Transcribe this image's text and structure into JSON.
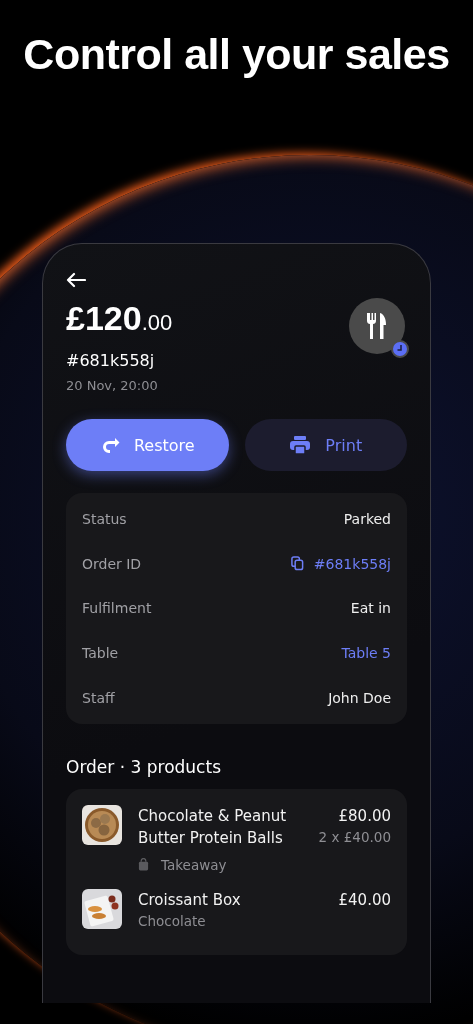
{
  "headline": "Control all your sales",
  "order": {
    "amount_main": "£120",
    "amount_cents": ".00",
    "id": "#681k558j",
    "date": "20 Nov, 20:00",
    "pending": true
  },
  "buttons": [
    {
      "label": "Restore",
      "kind": "primary"
    },
    {
      "label": "Print",
      "kind": "secondary"
    }
  ],
  "details": [
    {
      "label": "Status",
      "value": "Parked",
      "kind": "plain"
    },
    {
      "label": "Order ID",
      "value": "#681k558j",
      "kind": "copy"
    },
    {
      "label": "Fulfilment",
      "value": "Eat in",
      "kind": "plain"
    },
    {
      "label": "Table",
      "value": "Table 5",
      "kind": "link"
    },
    {
      "label": "Staff",
      "value": "John Doe",
      "kind": "plain"
    }
  ],
  "order_heading": "Order · 3 products",
  "products": [
    {
      "name": "Chocolate & Peanut Butter Protein Balls",
      "price": "£80.00",
      "unit_price": "2 x £40.00",
      "tag": "Takeaway",
      "kind": "picture"
    },
    {
      "name": "Croissant Box",
      "price": "£40.00",
      "variant": "Chocolate",
      "kind": "picture"
    }
  ]
}
